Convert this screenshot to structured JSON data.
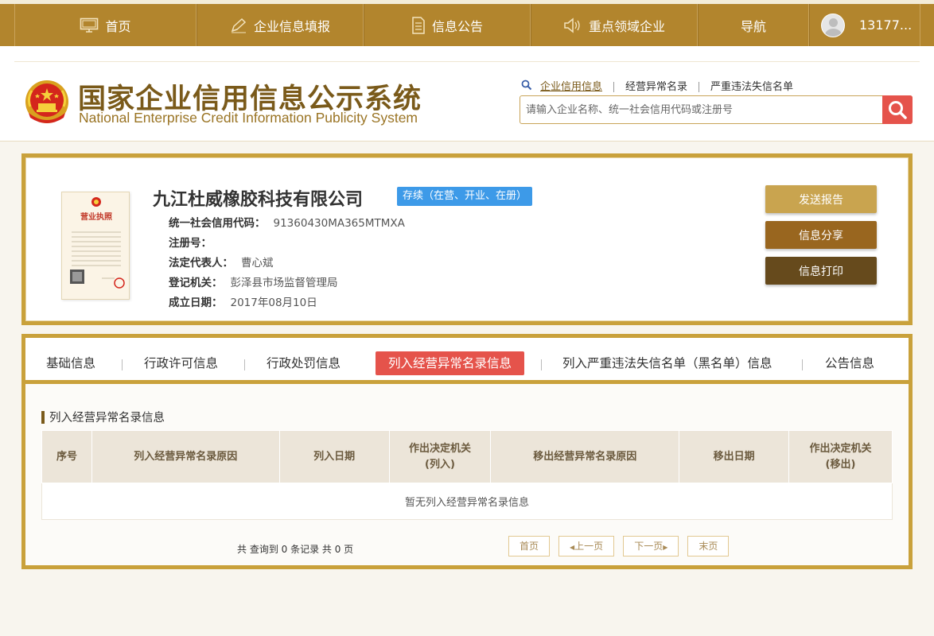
{
  "topnav": {
    "home": "首页",
    "fill": "企业信息填报",
    "notice": "信息公告",
    "key_field": "重点领域企业",
    "navigation": "导航",
    "user": "13177..."
  },
  "header": {
    "title": "国家企业信用信息公示系统",
    "subtitle": "National Enterprise Credit Information Publicity System",
    "links": [
      "企业信用信息",
      "经营异常名录",
      "严重违法失信名单"
    ],
    "search_placeholder": "请输入企业名称、统一社会信用代码或注册号"
  },
  "company": {
    "license_title": "营业执照",
    "name": "九江杜威橡胶科技有限公司",
    "status": "存续（在营、开业、在册）",
    "fields": [
      {
        "label": "统一社会信用代码：",
        "value": "91360430MA365MTMXA"
      },
      {
        "label": "注册号：",
        "value": ""
      },
      {
        "label": "法定代表人：",
        "value": "曹心斌"
      },
      {
        "label": "登记机关：",
        "value": "彭泽县市场监督管理局"
      },
      {
        "label": "成立日期：",
        "value": "2017年08月10日"
      }
    ],
    "buttons": {
      "send": "发送报告",
      "share": "信息分享",
      "print": "信息打印"
    }
  },
  "tabs": [
    "基础信息",
    "行政许可信息",
    "行政处罚信息",
    "列入经营异常名录信息",
    "列入严重违法失信名单（黑名单）信息",
    "公告信息"
  ],
  "section": {
    "title": "列入经营异常名录信息",
    "columns": [
      "序号",
      "列入经营异常名录原因",
      "列入日期",
      "作出决定机关(列入)",
      "移出经营异常名录原因",
      "移出日期",
      "作出决定机关(移出)"
    ],
    "empty": "暂无列入经营异常名录信息"
  },
  "pager": {
    "count": "共 查询到 0 条记录 共 0 页",
    "first": "首页",
    "prev": "上一页",
    "next": "下一页",
    "last": "末页"
  },
  "colors": {
    "gold": "#b2852d",
    "frame": "#c9a13b",
    "accent_red": "#e5534b",
    "status_blue": "#3d9ae8"
  }
}
